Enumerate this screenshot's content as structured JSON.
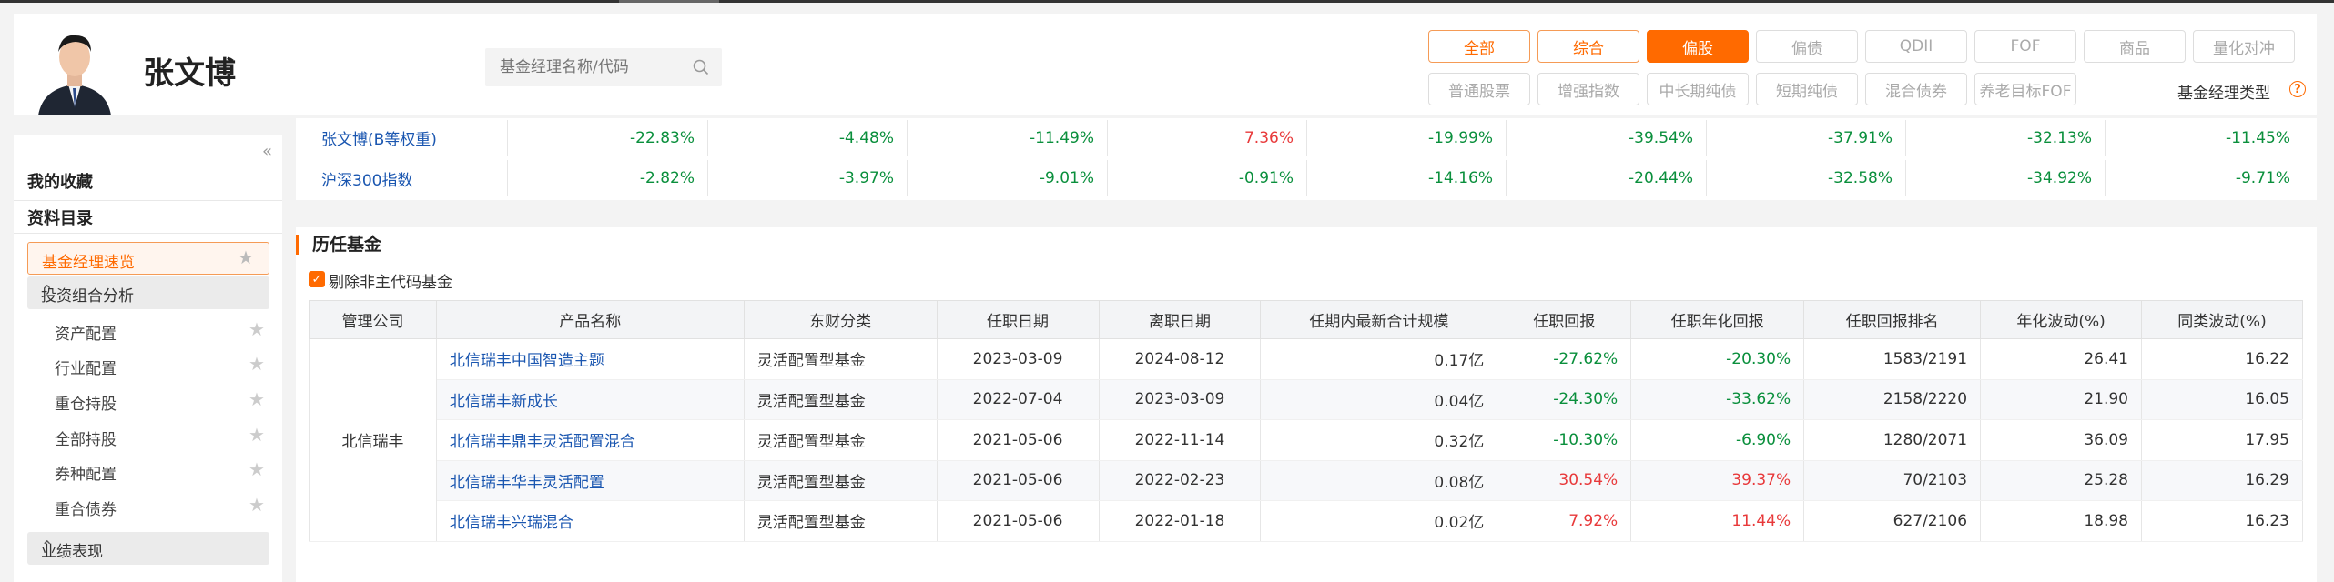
{
  "manager": {
    "name": "张文博"
  },
  "search": {
    "placeholder": "基金经理名称/代码"
  },
  "type_row1": [
    "全部",
    "综合",
    "偏股",
    "偏债",
    "QDII",
    "FOF",
    "商品",
    "量化对冲"
  ],
  "type_row2": [
    "普通股票",
    "增强指数",
    "中长期纯债",
    "短期纯债",
    "混合债券",
    "养老目标FOF"
  ],
  "type_label": "基金经理类型",
  "sidebar": {
    "favorites": "我的收藏",
    "catalog": "资料目录",
    "active_item": "基金经理速览",
    "group1": "投资组合分析",
    "group1_items": [
      "资产配置",
      "行业配置",
      "重仓持股",
      "全部持股",
      "券种配置",
      "重合债券"
    ],
    "group2": "业绩表现"
  },
  "perf": {
    "rows": [
      {
        "name": "张文博(B等权重)",
        "values": [
          "-22.83%",
          "-4.48%",
          "-11.49%",
          "7.36%",
          "-19.99%",
          "-39.54%",
          "-37.91%",
          "-32.13%",
          "-11.45%"
        ],
        "colors": [
          "green",
          "green",
          "green",
          "red",
          "green",
          "green",
          "green",
          "green",
          "green"
        ]
      },
      {
        "name": "沪深300指数",
        "values": [
          "-2.82%",
          "-3.97%",
          "-9.01%",
          "-0.91%",
          "-14.16%",
          "-20.44%",
          "-32.58%",
          "-34.92%",
          "-9.71%"
        ],
        "colors": [
          "green",
          "green",
          "green",
          "green",
          "green",
          "green",
          "green",
          "green",
          "green"
        ]
      }
    ]
  },
  "history": {
    "title": "历任基金",
    "checkbox_label": "剔除非主代码基金",
    "headers": [
      "管理公司",
      "产品名称",
      "东财分类",
      "任职日期",
      "离职日期",
      "任期内最新合计规模",
      "任职回报",
      "任职年化回报",
      "任职回报排名",
      "年化波动(%)",
      "同类波动(%)"
    ],
    "company": "北信瑞丰",
    "rows": [
      {
        "name": "北信瑞丰中国智造主题",
        "category": "灵活配置型基金",
        "start": "2023-03-09",
        "end": "2024-08-12",
        "scale": "0.17亿",
        "ret": "-27.62%",
        "ret_color": "green",
        "annual": "-20.30%",
        "annual_color": "green",
        "rank": "1583/2191",
        "vol": "26.41",
        "peer_vol": "16.22"
      },
      {
        "name": "北信瑞丰新成长",
        "category": "灵活配置型基金",
        "start": "2022-07-04",
        "end": "2023-03-09",
        "scale": "0.04亿",
        "ret": "-24.30%",
        "ret_color": "green",
        "annual": "-33.62%",
        "annual_color": "green",
        "rank": "2158/2220",
        "vol": "21.90",
        "peer_vol": "16.05"
      },
      {
        "name": "北信瑞丰鼎丰灵活配置混合",
        "category": "灵活配置型基金",
        "start": "2021-05-06",
        "end": "2022-11-14",
        "scale": "0.32亿",
        "ret": "-10.30%",
        "ret_color": "green",
        "annual": "-6.90%",
        "annual_color": "green",
        "rank": "1280/2071",
        "vol": "36.09",
        "peer_vol": "17.95"
      },
      {
        "name": "北信瑞丰华丰灵活配置",
        "category": "灵活配置型基金",
        "start": "2021-05-06",
        "end": "2022-02-23",
        "scale": "0.08亿",
        "ret": "30.54%",
        "ret_color": "red",
        "annual": "39.37%",
        "annual_color": "red",
        "rank": "70/2103",
        "vol": "25.28",
        "peer_vol": "16.29"
      },
      {
        "name": "北信瑞丰兴瑞混合",
        "category": "灵活配置型基金",
        "start": "2021-05-06",
        "end": "2022-01-18",
        "scale": "0.02亿",
        "ret": "7.92%",
        "ret_color": "red",
        "annual": "11.44%",
        "annual_color": "red",
        "rank": "627/2106",
        "vol": "18.98",
        "peer_vol": "16.23"
      }
    ]
  },
  "colors": {
    "accent": "#ff6a00",
    "link": "#1a56b0",
    "up": "#e8393a",
    "down": "#0a8f3c"
  }
}
